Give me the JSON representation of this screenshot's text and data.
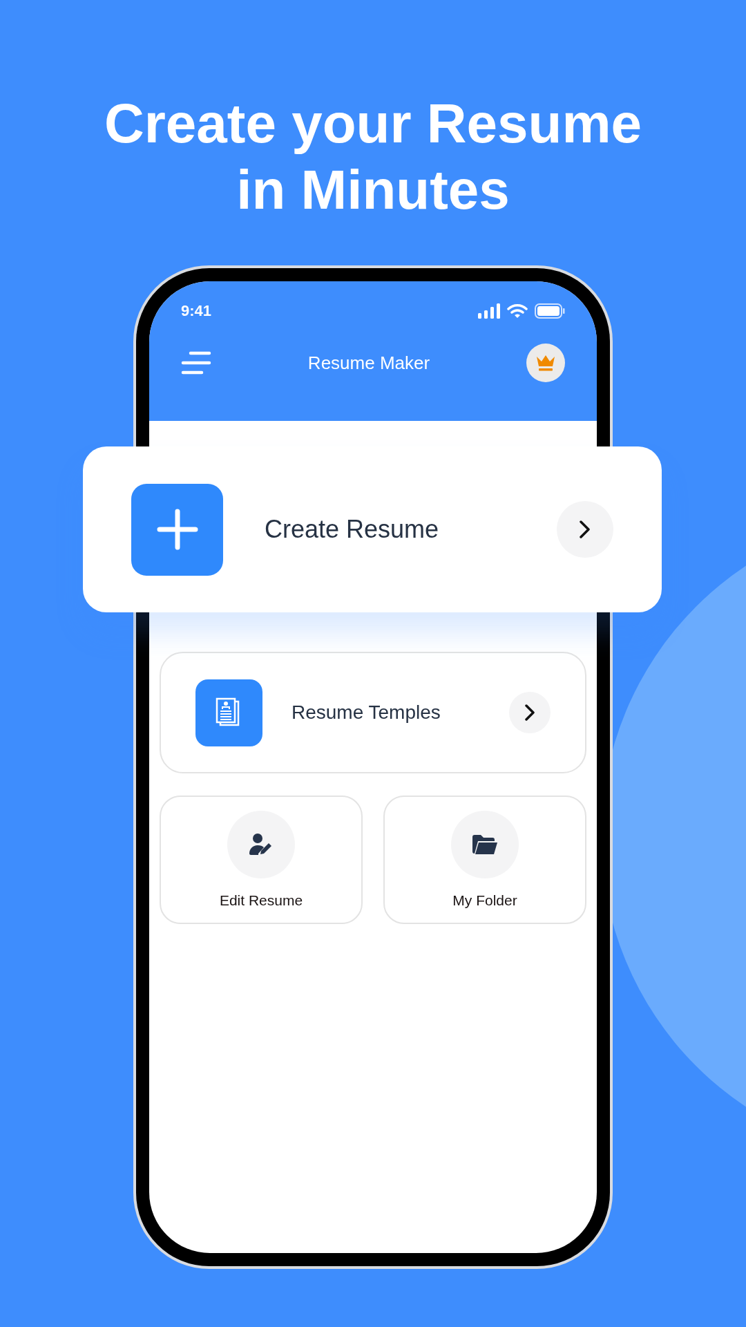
{
  "headline": [
    "Create your Resume",
    "in Minutes"
  ],
  "status_bar": {
    "time": "9:41"
  },
  "app_bar": {
    "title": "Resume Maker"
  },
  "featured_card": {
    "label": "Create Resume"
  },
  "list_card": {
    "label": "Resume Temples"
  },
  "tiles": [
    {
      "label": "Edit Resume",
      "kind": "edit"
    },
    {
      "label": "My Folder",
      "kind": "folder"
    }
  ]
}
